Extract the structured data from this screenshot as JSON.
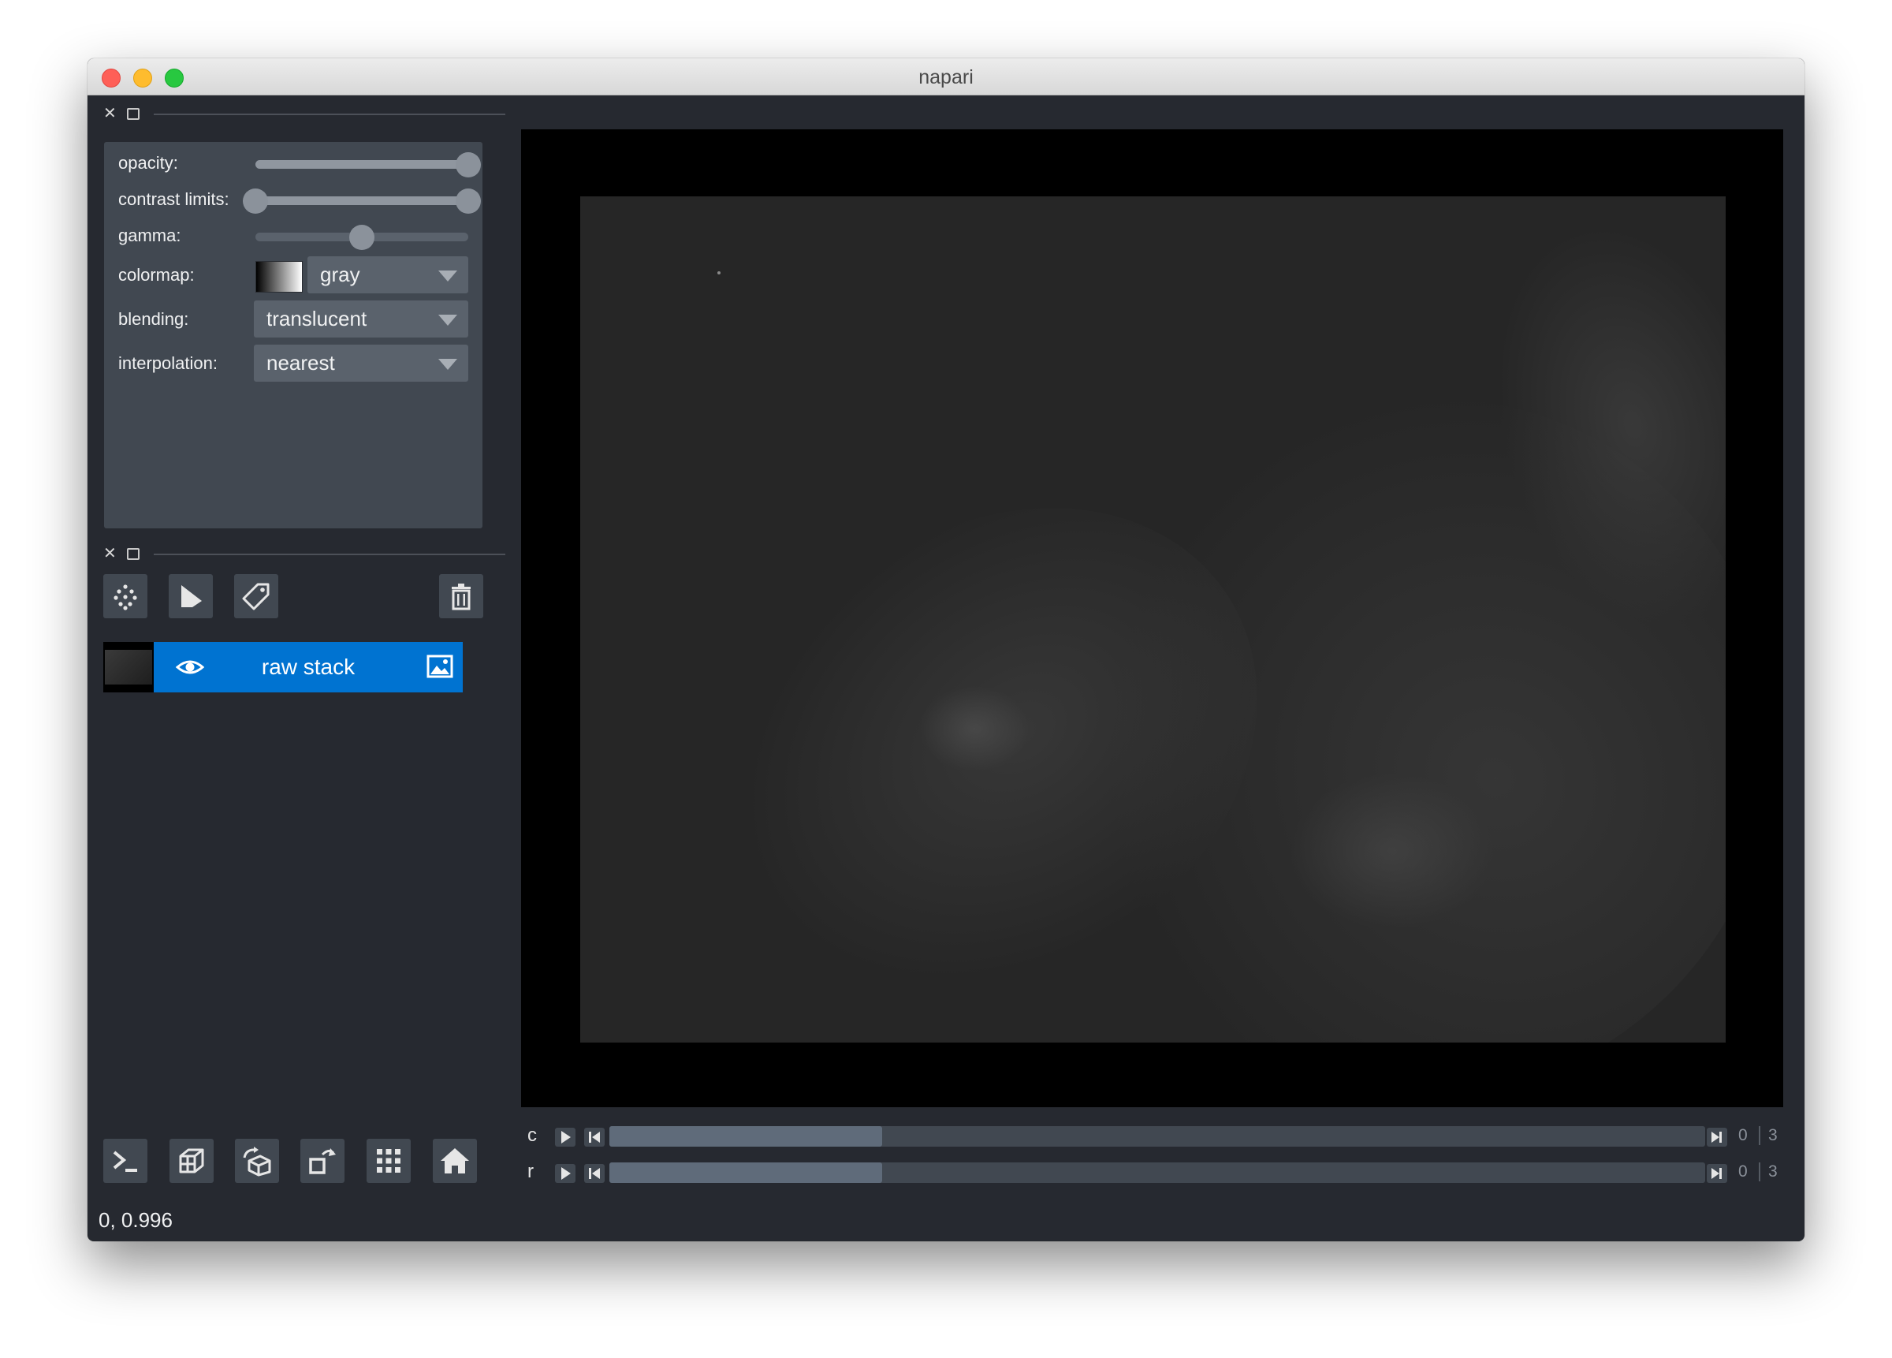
{
  "window": {
    "title": "napari"
  },
  "layer_controls": {
    "opacity_label": "opacity:",
    "contrast_label": "contrast limits:",
    "gamma_label": "gamma:",
    "colormap_label": "colormap:",
    "blending_label": "blending:",
    "interpolation_label": "interpolation:",
    "opacity_value": 1.0,
    "contrast_min": 0.0,
    "contrast_max": 1.0,
    "gamma_value": 0.5,
    "colormap_value": "gray",
    "blending_value": "translucent",
    "interpolation_value": "nearest"
  },
  "layer_buttons": {
    "new_points_icon": "points-icon",
    "new_shapes_icon": "shapes-icon",
    "new_labels_icon": "labels-tag-icon",
    "delete_icon": "trash-icon"
  },
  "layers": [
    {
      "name": "raw stack",
      "visible": true,
      "type_icon": "image-icon",
      "selected_color": "#0073d1"
    }
  ],
  "viewer_buttons": [
    "console-icon",
    "ndisplay-icon",
    "roll-dims-icon",
    "transpose-icon",
    "grid-icon",
    "home-icon"
  ],
  "dims": [
    {
      "label": "c",
      "current": "0",
      "max": "3",
      "position_fraction": 0.0
    },
    {
      "label": "r",
      "current": "0",
      "max": "3",
      "position_fraction": 0.0
    }
  ],
  "status_bar": {
    "text": "0, 0.996"
  },
  "colors": {
    "background": "#262930",
    "panel": "#414851",
    "highlight": "#0073d1"
  }
}
